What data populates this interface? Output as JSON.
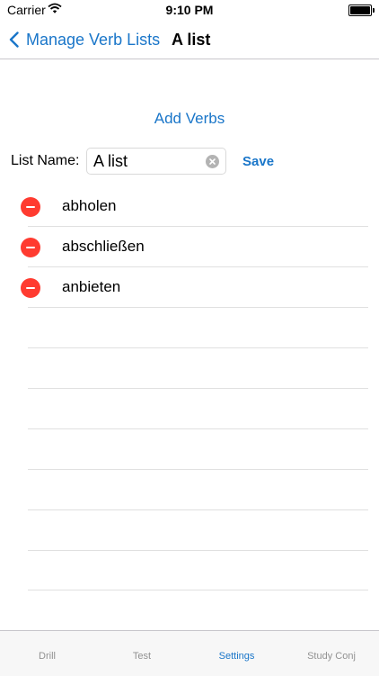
{
  "status_bar": {
    "carrier": "Carrier",
    "time": "9:10 PM"
  },
  "nav": {
    "back_label": "Manage Verb Lists",
    "title": "A list"
  },
  "add_verbs_label": "Add Verbs",
  "list_name": {
    "label": "List Name:",
    "value": "A list",
    "save_label": "Save"
  },
  "verbs": [
    "abholen",
    "abschließen",
    "anbieten"
  ],
  "tabs": [
    {
      "label": "Drill",
      "active": false
    },
    {
      "label": "Test",
      "active": false
    },
    {
      "label": "Settings",
      "active": true
    },
    {
      "label": "Study Conj",
      "active": false
    }
  ],
  "colors": {
    "accent": "#1a76c9",
    "delete": "#ff3b30"
  }
}
